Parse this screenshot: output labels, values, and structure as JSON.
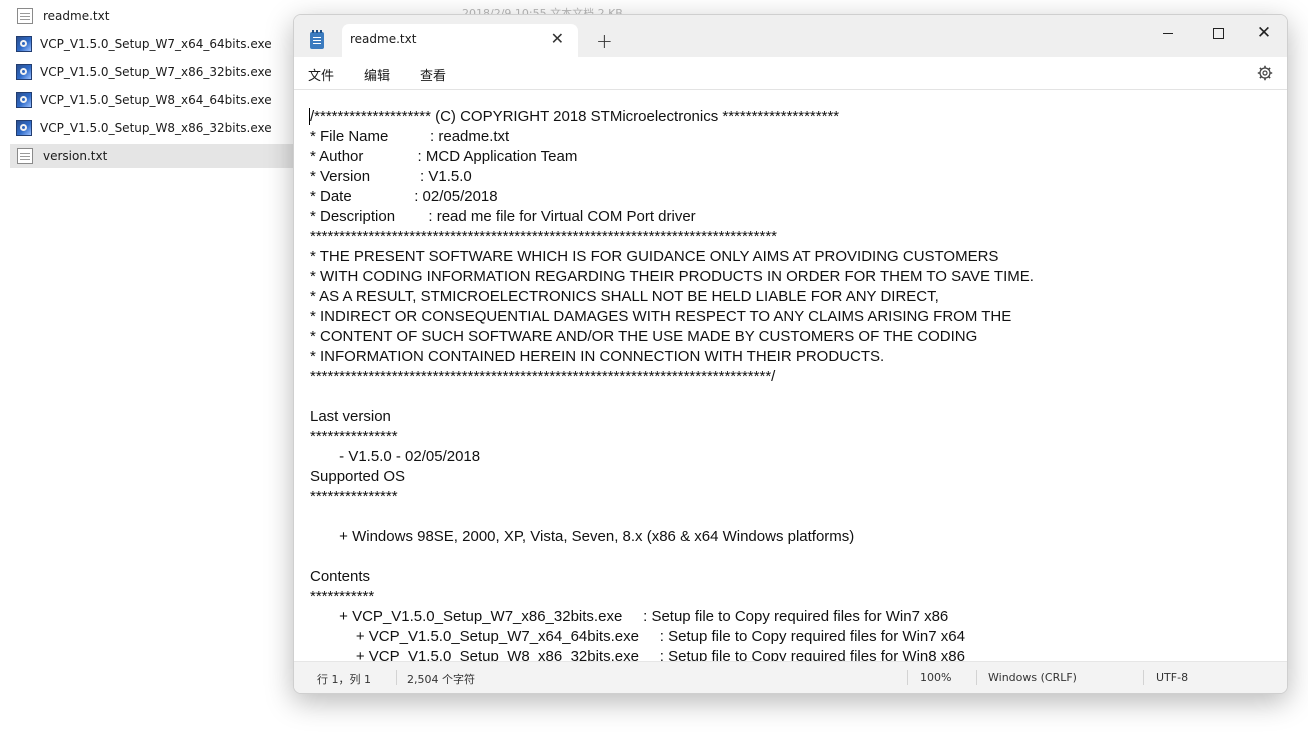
{
  "explorer": {
    "ghost_text": "2018/2/9 10:55          文本文档                    2 KB",
    "files": [
      {
        "name": "readme.txt",
        "type": "txt",
        "selected": false
      },
      {
        "name": "VCP_V1.5.0_Setup_W7_x64_64bits.exe",
        "type": "exe",
        "selected": false
      },
      {
        "name": "VCP_V1.5.0_Setup_W7_x86_32bits.exe",
        "type": "exe",
        "selected": false
      },
      {
        "name": "VCP_V1.5.0_Setup_W8_x64_64bits.exe",
        "type": "exe",
        "selected": false
      },
      {
        "name": "VCP_V1.5.0_Setup_W8_x86_32bits.exe",
        "type": "exe",
        "selected": false
      },
      {
        "name": "version.txt",
        "type": "txt",
        "selected": true
      }
    ]
  },
  "notepad": {
    "tab_title": "readme.txt",
    "menu": {
      "file": "文件",
      "edit": "编辑",
      "view": "查看"
    },
    "content_lines": [
      "/******************** (C) COPYRIGHT 2018 STMicroelectronics ********************",
      "* File Name          : readme.txt",
      "* Author             : MCD Application Team",
      "* Version            : V1.5.0",
      "* Date               : 02/05/2018",
      "* Description        : read me file for Virtual COM Port driver",
      "********************************************************************************",
      "* THE PRESENT SOFTWARE WHICH IS FOR GUIDANCE ONLY AIMS AT PROVIDING CUSTOMERS",
      "* WITH CODING INFORMATION REGARDING THEIR PRODUCTS IN ORDER FOR THEM TO SAVE TIME.",
      "* AS A RESULT, STMICROELECTRONICS SHALL NOT BE HELD LIABLE FOR ANY DIRECT,",
      "* INDIRECT OR CONSEQUENTIAL DAMAGES WITH RESPECT TO ANY CLAIMS ARISING FROM THE",
      "* CONTENT OF SUCH SOFTWARE AND/OR THE USE MADE BY CUSTOMERS OF THE CODING",
      "* INFORMATION CONTAINED HEREIN IN CONNECTION WITH THEIR PRODUCTS.",
      "*******************************************************************************/",
      "",
      "Last version",
      "***************",
      "       - V1.5.0 - 02/05/2018",
      "Supported OS",
      "***************",
      "",
      "       + Windows 98SE, 2000, XP, Vista, Seven, 8.x (x86 & x64 Windows platforms)",
      "",
      "Contents",
      "***********",
      "       + VCP_V1.5.0_Setup_W7_x86_32bits.exe     : Setup file to Copy required files for Win7 x86",
      "           + VCP_V1.5.0_Setup_W7_x64_64bits.exe     : Setup file to Copy required files for Win7 x64",
      "           + VCP_V1.5.0_Setup_W8_x86_32bits.exe     : Setup file to Copy required files for Win8 x86"
    ],
    "status": {
      "position": "行 1，列 1",
      "chars": "2,504 个字符",
      "zoom": "100%",
      "line_ending": "Windows (CRLF)",
      "encoding": "UTF-8"
    }
  },
  "icons": [
    "txt-file-icon",
    "exe-file-icon",
    "notepad-app-icon",
    "close-icon",
    "plus-icon",
    "minimize-icon",
    "maximize-icon",
    "gear-icon"
  ]
}
